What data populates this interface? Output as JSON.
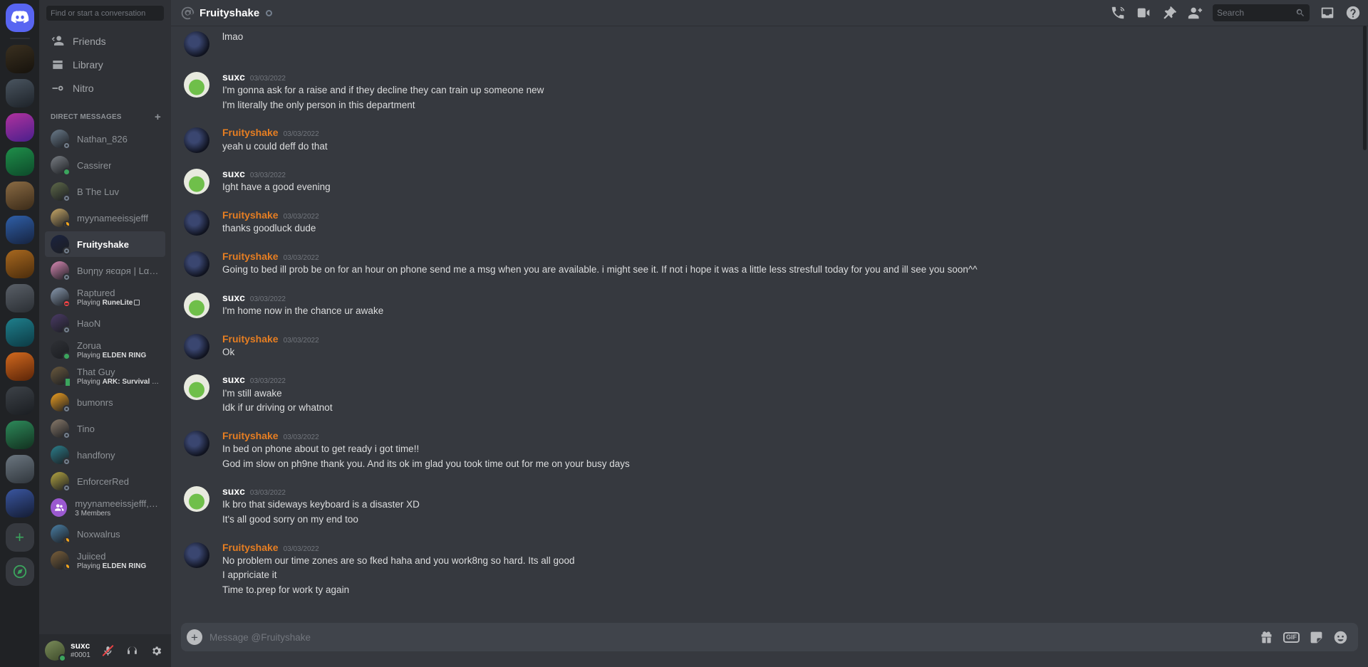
{
  "server_rail": {
    "home_tooltip": "Direct Messages",
    "add_server_label": "+",
    "explore_label": "Explore Public Servers",
    "servers": [
      {
        "name": "server-knight",
        "color": "#2c2f33"
      },
      {
        "name": "server-portrait",
        "color": "#3a3f44"
      },
      {
        "name": "server-w",
        "color": "#7b2d8e"
      },
      {
        "name": "server-pet",
        "color": "#1f6f3a"
      },
      {
        "name": "server-monkey",
        "color": "#6b5336"
      },
      {
        "name": "server-blue",
        "color": "#2b4a7d"
      },
      {
        "name": "server-world",
        "color": "#8a5a2b"
      },
      {
        "name": "server-gray",
        "color": "#4a4f55"
      },
      {
        "name": "server-teal",
        "color": "#1d6e6e"
      },
      {
        "name": "server-orange",
        "color": "#c0561f"
      },
      {
        "name": "server-dark",
        "color": "#33373c"
      },
      {
        "name": "server-chart",
        "color": "#2d7a4f"
      },
      {
        "name": "server-scene",
        "color": "#56616b"
      },
      {
        "name": "server-fortnite",
        "color": "#2a3f6b"
      }
    ]
  },
  "sidebar": {
    "search_placeholder": "Find or start a conversation",
    "nav": [
      {
        "label": "Friends",
        "icon": "friends-icon"
      },
      {
        "label": "Library",
        "icon": "library-icon"
      },
      {
        "label": "Nitro",
        "icon": "nitro-icon"
      }
    ],
    "dm_header": "DIRECT MESSAGES",
    "dm_add_label": "+",
    "dms": [
      {
        "name": "Nathan_826",
        "status": "offline",
        "activity": "",
        "active": false,
        "avatar": "#6b7c8c"
      },
      {
        "name": "Cassirer",
        "status": "online",
        "activity": "",
        "active": false,
        "avatar": "#7a7f85"
      },
      {
        "name": "B The Luv",
        "status": "offline",
        "activity": "",
        "active": false,
        "avatar": "#5f6a4a"
      },
      {
        "name": "myynameeissjefff",
        "status": "idle",
        "activity": "",
        "active": false,
        "avatar": "#c9a968"
      },
      {
        "name": "Fruityshake",
        "status": "offline",
        "activity": "",
        "active": true,
        "avatar": "#1b2340"
      },
      {
        "name": "Bυηηy яєαρя | Lαηɗ ɑ...",
        "status": "offline",
        "activity": "",
        "active": false,
        "avatar": "#d98ab5"
      },
      {
        "name": "Raptured",
        "status": "dnd",
        "activity_prefix": "Playing",
        "activity": "RuneLite",
        "has_device_icon": true,
        "active": false,
        "avatar": "#8a9bb0"
      },
      {
        "name": "HaoN",
        "status": "offline",
        "activity": "",
        "active": false,
        "avatar": "#4b3b66"
      },
      {
        "name": "Zorua",
        "status": "online",
        "activity_prefix": "Playing",
        "activity": "ELDEN RING",
        "active": false,
        "avatar": "#2f3136"
      },
      {
        "name": "That Guy",
        "status": "mobile",
        "activity_prefix": "Playing",
        "activity": "ARK: Survival Evolved",
        "active": false,
        "avatar": "#6b5a3e"
      },
      {
        "name": "bumonrs",
        "status": "offline",
        "activity": "",
        "active": false,
        "avatar": "#f0a020"
      },
      {
        "name": "Tino",
        "status": "offline",
        "activity": "",
        "active": false,
        "avatar": "#8a7b6b"
      },
      {
        "name": "handfony",
        "status": "offline",
        "activity": "",
        "active": false,
        "avatar": "#2b7f8c"
      },
      {
        "name": "EnforcerRed",
        "status": "offline",
        "activity": "",
        "active": false,
        "avatar": "#b5a642"
      },
      {
        "name": "myynameeissjefff, bu...",
        "status": "none",
        "activity": "3 Members",
        "is_group": true,
        "active": false,
        "avatar": "#9b59d0"
      },
      {
        "name": "Noxwalrus",
        "status": "idle",
        "activity": "",
        "active": false,
        "avatar": "#4a7fa5"
      },
      {
        "name": "Juiiced",
        "status": "idle",
        "activity_prefix": "Playing",
        "activity": "ELDEN RING",
        "active": false,
        "avatar": "#7a5f3a"
      }
    ]
  },
  "user_panel": {
    "username": "suxc",
    "discriminator": "#0001",
    "status": "online",
    "mute_icon": "microphone-muted-icon",
    "deafen_icon": "headphones-icon",
    "settings_icon": "gear-icon"
  },
  "header": {
    "at_icon": "at-sign-icon",
    "title": "Fruityshake",
    "status": "offline",
    "actions": [
      {
        "name": "start-voice-call-button",
        "icon": "phone-call-icon"
      },
      {
        "name": "start-video-call-button",
        "icon": "video-camera-icon"
      },
      {
        "name": "pinned-messages-button",
        "icon": "pin-icon"
      },
      {
        "name": "add-friends-button",
        "icon": "add-person-icon"
      }
    ],
    "search_placeholder": "Search",
    "inbox_icon": "inbox-icon",
    "help_icon": "help-circle-icon"
  },
  "messages": [
    {
      "author": "Fruityshake",
      "author_type": "fruity",
      "timestamp": "",
      "continued": true,
      "avatar": "#1b2340",
      "lines": [
        "lmao"
      ]
    },
    {
      "author": "suxc",
      "author_type": "suxc",
      "timestamp": "03/03/2022",
      "continued": false,
      "avatar": "#cfe3c8",
      "lines": [
        "I'm gonna ask for a raise and if they decline they can train up someone new",
        "I'm literally the only person in this department"
      ]
    },
    {
      "author": "Fruityshake",
      "author_type": "fruity",
      "timestamp": "03/03/2022",
      "continued": false,
      "avatar": "#1b2340",
      "lines": [
        "yeah u could deff do that"
      ]
    },
    {
      "author": "suxc",
      "author_type": "suxc",
      "timestamp": "03/03/2022",
      "continued": false,
      "avatar": "#cfe3c8",
      "lines": [
        "Ight have a good evening"
      ]
    },
    {
      "author": "Fruityshake",
      "author_type": "fruity",
      "timestamp": "03/03/2022",
      "continued": false,
      "avatar": "#1b2340",
      "lines": [
        "thanks goodluck dude"
      ]
    },
    {
      "author": "Fruityshake",
      "author_type": "fruity",
      "timestamp": "03/03/2022",
      "continued": false,
      "avatar": "#1b2340",
      "lines": [
        "Going to bed ill prob be on for an hour on phone send me a msg when you are available. i might see it. If not i hope it was a little less stresfull today for you and ill see you soon^^"
      ]
    },
    {
      "author": "suxc",
      "author_type": "suxc",
      "timestamp": "03/03/2022",
      "continued": false,
      "avatar": "#cfe3c8",
      "lines": [
        "I'm home now in the chance ur awake"
      ]
    },
    {
      "author": "Fruityshake",
      "author_type": "fruity",
      "timestamp": "03/03/2022",
      "continued": false,
      "avatar": "#1b2340",
      "lines": [
        "Ok"
      ]
    },
    {
      "author": "suxc",
      "author_type": "suxc",
      "timestamp": "03/03/2022",
      "continued": false,
      "avatar": "#cfe3c8",
      "lines": [
        "I'm still awake",
        "Idk if ur driving or whatnot"
      ]
    },
    {
      "author": "Fruityshake",
      "author_type": "fruity",
      "timestamp": "03/03/2022",
      "continued": false,
      "avatar": "#1b2340",
      "lines": [
        "In bed on phone about to get ready i got time!!",
        "God im slow on ph9ne thank you. And its ok im glad you took time out for me on your busy days"
      ]
    },
    {
      "author": "suxc",
      "author_type": "suxc",
      "timestamp": "03/03/2022",
      "continued": false,
      "avatar": "#cfe3c8",
      "lines": [
        "Ik bro that sideways keyboard is a disaster  XD",
        "It's all good sorry on my end too"
      ]
    },
    {
      "author": "Fruityshake",
      "author_type": "fruity",
      "timestamp": "03/03/2022",
      "continued": false,
      "avatar": "#1b2340",
      "lines": [
        "No problem our time zones are so fked haha and you work8ng so hard. Its all good",
        "I appriciate it",
        "Time to.prep for work ty again"
      ]
    }
  ],
  "composer": {
    "attach_label": "+",
    "placeholder": "Message @Fruityshake",
    "actions": [
      {
        "name": "gift-button",
        "icon": "gift-icon"
      },
      {
        "name": "gif-button",
        "icon": "gif-icon",
        "label": "GIF"
      },
      {
        "name": "sticker-button",
        "icon": "sticker-icon"
      },
      {
        "name": "emoji-button",
        "icon": "emoji-icon"
      }
    ]
  }
}
